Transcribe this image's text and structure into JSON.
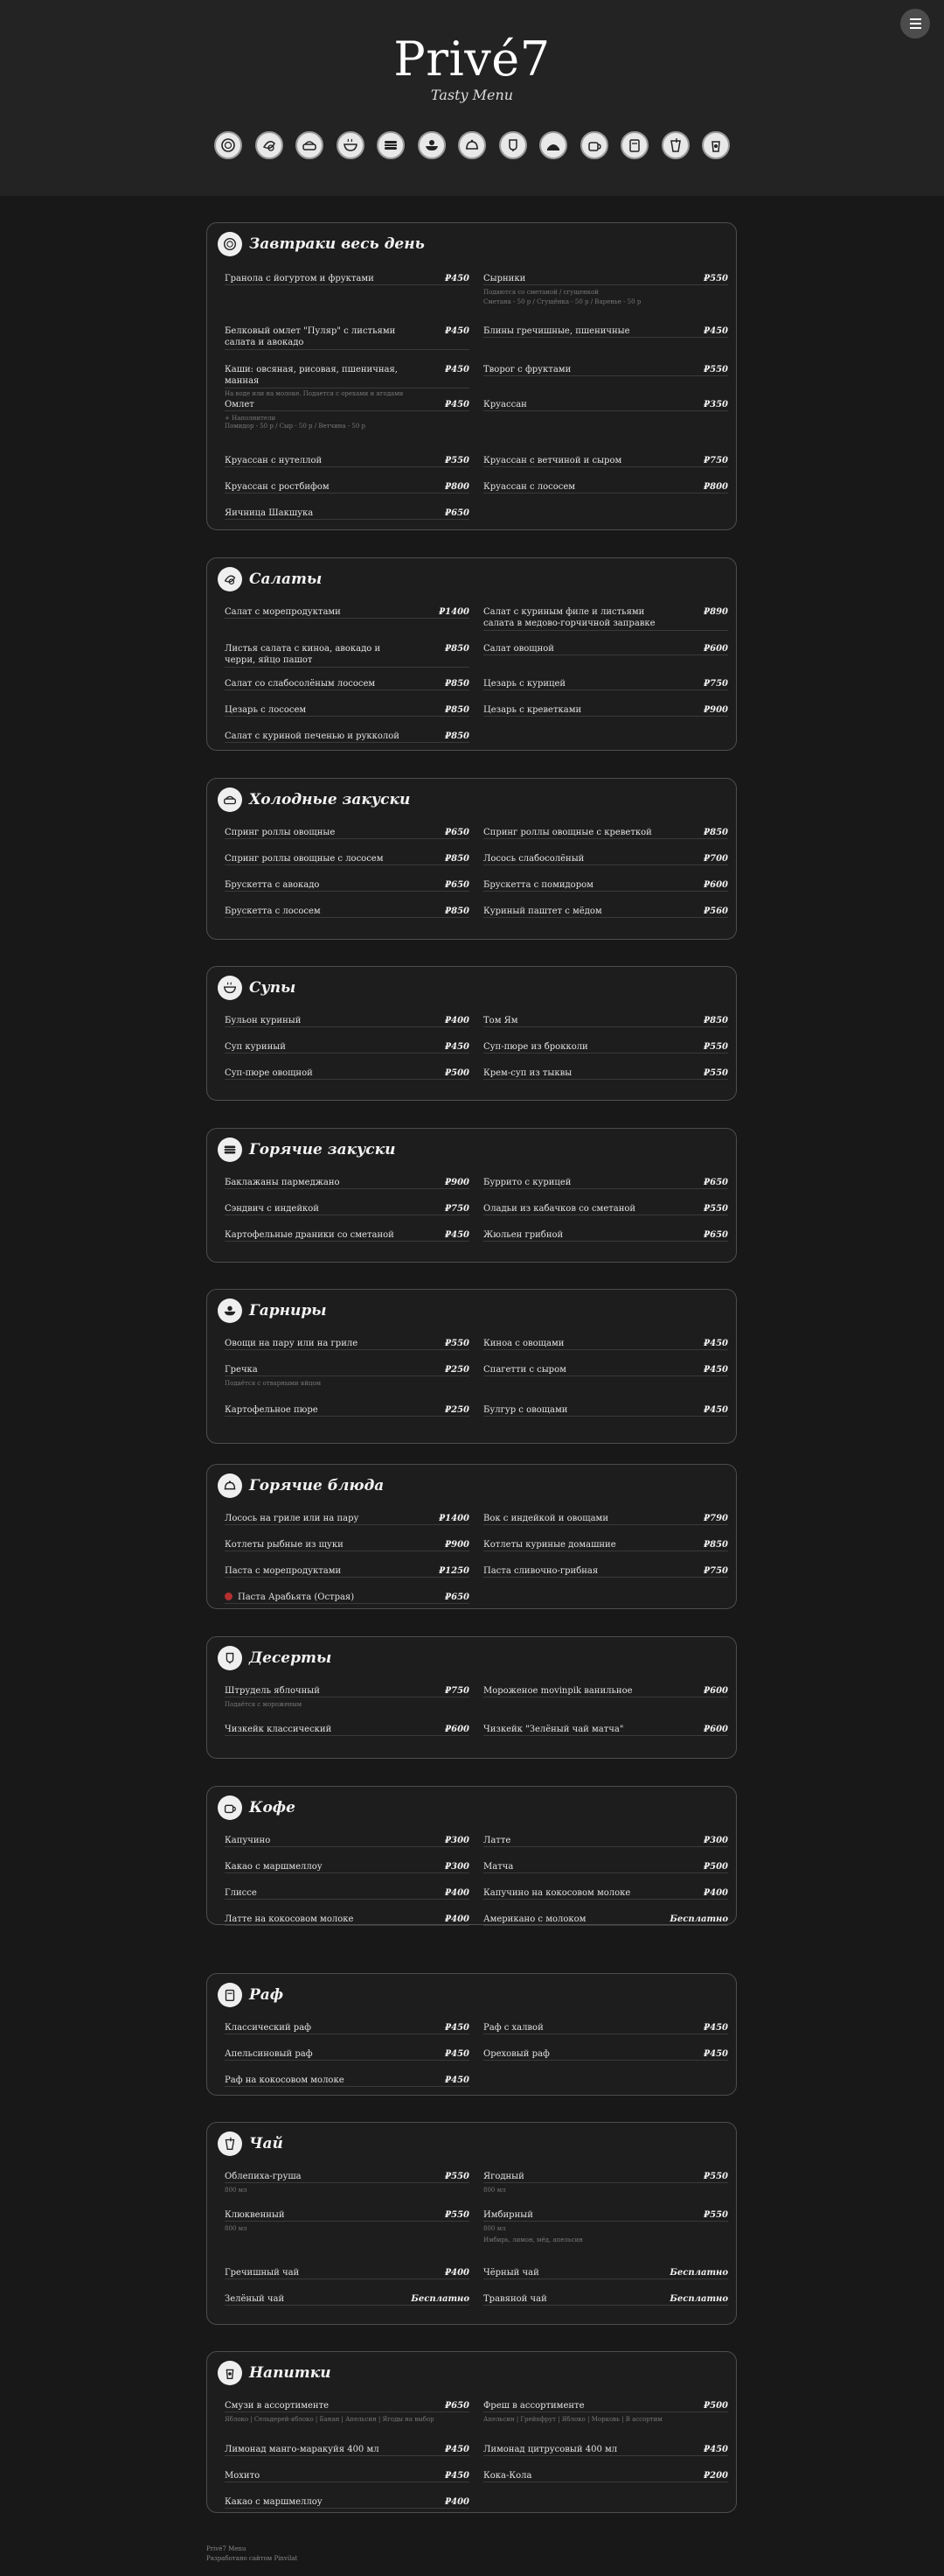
{
  "header": {
    "logo": "Privé7",
    "tagline": "Tasty Menu"
  },
  "categories": [
    "breakfast-icon",
    "salad-icon",
    "cold-appetizers-icon",
    "soup-icon",
    "hot-appetizers-icon",
    "side-dishes-icon",
    "main-courses-icon",
    "desserts-icon",
    "coffee-icon",
    "raf-icon",
    "tea-icon",
    "drinks-icon",
    "extra-icon"
  ],
  "sections": [
    {
      "title": "Завтраки весь день",
      "items": [
        {
          "name": "Гранола с йогуртом и фруктами",
          "price": "₽450"
        },
        {
          "name": "Сырники",
          "price": "₽550",
          "desc": "Подаются со сметаной / сгущенкой"
        },
        {
          "name": "",
          "price": "",
          "desc": "Сметана - 50 р / Сгущёнка - 50 р / Варенье - 50 р"
        },
        {
          "name": "Белковый омлет \"Пуляр\" с листьями салата и авокадо",
          "price": "₽450"
        },
        {
          "name": "Блины гречишные, пшеничные",
          "price": "₽450"
        },
        {
          "name": "Каши: овсяная, рисовая, пшеничная, манная",
          "price": "₽450",
          "desc": "На воде или на молоке. Подается с орехами и ягодами"
        },
        {
          "name": "Творог с фруктами",
          "price": "₽550"
        },
        {
          "name": "Омлет",
          "price": "₽450",
          "desc": "+ Наполнители"
        },
        {
          "name": "Круассан",
          "price": "₽350"
        },
        {
          "name": "",
          "price": "",
          "desc": "Помидор - 50 р / Сыр - 50 р / Ветчина - 50 р"
        },
        {
          "name": "Круассан с нутеллой",
          "price": "₽550"
        },
        {
          "name": "Круассан с ветчиной и сыром",
          "price": "₽750"
        },
        {
          "name": "Круассан с ростбифом",
          "price": "₽800"
        },
        {
          "name": "Круассан с лососем",
          "price": "₽800"
        },
        {
          "name": "Яичница Шакшука",
          "price": "₽650"
        }
      ]
    },
    {
      "title": "Салаты",
      "items": [
        {
          "name": "Салат с морепродуктами",
          "price": "₽1400"
        },
        {
          "name": "Салат с куриным филе и листьями салата в медово-горчичной заправке",
          "price": "₽890"
        },
        {
          "name": "Листья салата с киноа, авокадо и черри, яйцо пашот",
          "price": "₽850"
        },
        {
          "name": "Салат овощной",
          "price": "₽600"
        },
        {
          "name": "Салат со слабосолёным лососем",
          "price": "₽850"
        },
        {
          "name": "Цезарь с курицей",
          "price": "₽750"
        },
        {
          "name": "Цезарь с лососем",
          "price": "₽850"
        },
        {
          "name": "Цезарь с креветками",
          "price": "₽900"
        },
        {
          "name": "Салат с куриной печенью и рукколой",
          "price": "₽850"
        }
      ]
    },
    {
      "title": "Холодные закуски",
      "items": [
        {
          "name": "Спринг роллы овощные",
          "price": "₽650"
        },
        {
          "name": "Спринг роллы овощные с креветкой",
          "price": "₽850"
        },
        {
          "name": "Спринг роллы овощные с лососем",
          "price": "₽850"
        },
        {
          "name": "Лосось слабосолёный",
          "price": "₽700"
        },
        {
          "name": "Брускетта с авокадо",
          "price": "₽650"
        },
        {
          "name": "Брускетта с помидором",
          "price": "₽600"
        },
        {
          "name": "Брускетта с лососем",
          "price": "₽850"
        },
        {
          "name": "Куриный паштет с мёдом",
          "price": "₽560"
        }
      ]
    },
    {
      "title": "Супы",
      "items": [
        {
          "name": "Бульон куриный",
          "price": "₽400"
        },
        {
          "name": "Том Ям",
          "price": "₽850"
        },
        {
          "name": "Суп куриный",
          "price": "₽450"
        },
        {
          "name": "Суп-пюре из брокколи",
          "price": "₽550"
        },
        {
          "name": "Суп-пюре овощной",
          "price": "₽500"
        },
        {
          "name": "Крем-суп из тыквы",
          "price": "₽550"
        }
      ]
    },
    {
      "title": "Горячие закуски",
      "items": [
        {
          "name": "Баклажаны пармеджано",
          "price": "₽900"
        },
        {
          "name": "Буррито с курицей",
          "price": "₽650"
        },
        {
          "name": "Сэндвич с индейкой",
          "price": "₽750"
        },
        {
          "name": "Оладьи из кабачков со сметаной",
          "price": "₽550"
        },
        {
          "name": "Картофельные драники со сметаной",
          "price": "₽450"
        },
        {
          "name": "Жюльен грибной",
          "price": "₽650"
        }
      ]
    },
    {
      "title": "Гарниры",
      "items": [
        {
          "name": "Овощи на пару или на гриле",
          "price": "₽550"
        },
        {
          "name": "Киноа с овощами",
          "price": "₽450"
        },
        {
          "name": "Гречка",
          "price": "₽250",
          "desc": "Подаётся с отварными яйцом"
        },
        {
          "name": "Спагетти с сыром",
          "price": "₽450"
        },
        {
          "name": "Картофельное пюре",
          "price": "₽250"
        },
        {
          "name": "Булгур с овощами",
          "price": "₽450"
        }
      ]
    },
    {
      "title": "Горячие блюда",
      "items": [
        {
          "name": "Лосось на гриле или на пару",
          "price": "₽1400"
        },
        {
          "name": "Вок с индейкой и овощами",
          "price": "₽790"
        },
        {
          "name": "Котлеты рыбные из щуки",
          "price": "₽900"
        },
        {
          "name": "Котлеты куриные домашние",
          "price": "₽850"
        },
        {
          "name": "Паста с морепродуктами",
          "price": "₽1250"
        },
        {
          "name": "Паста сливочно-грибная",
          "price": "₽750"
        },
        {
          "name": "Паста Арабьята (Острая)",
          "price": "₽650",
          "hot": true
        }
      ]
    },
    {
      "title": "Десерты",
      "items": [
        {
          "name": "Штрудель яблочный",
          "price": "₽750",
          "desc": "Подаётся с мороженым"
        },
        {
          "name": "Мороженое movinpik ванильное",
          "price": "₽600"
        },
        {
          "name": "Чизкейк классический",
          "price": "₽600"
        },
        {
          "name": "Чизкейк \"Зелёный чай матча\"",
          "price": "₽600"
        }
      ]
    },
    {
      "title": "Кофе",
      "items": [
        {
          "name": "Капучино",
          "price": "₽300"
        },
        {
          "name": "Латте",
          "price": "₽300"
        },
        {
          "name": "Какао с маршмеллоу",
          "price": "₽300"
        },
        {
          "name": "Матча",
          "price": "₽500"
        },
        {
          "name": "Глиссе",
          "price": "₽400"
        },
        {
          "name": "Капучино на кокосовом молоке",
          "price": "₽400"
        },
        {
          "name": "Латте на кокосовом молоке",
          "price": "₽400"
        },
        {
          "name": "Американо с молоком",
          "price": "Бесплатно"
        }
      ]
    },
    {
      "title": "Раф",
      "items": [
        {
          "name": "Классический раф",
          "price": "₽450"
        },
        {
          "name": "Раф с халвой",
          "price": "₽450"
        },
        {
          "name": "Апельсиновый раф",
          "price": "₽450"
        },
        {
          "name": "Ореховый раф",
          "price": "₽450"
        },
        {
          "name": "Раф на кокосовом молоке",
          "price": "₽450"
        }
      ]
    },
    {
      "title": "Чай",
      "items": [
        {
          "name": "Облепиха-груша",
          "price": "₽550",
          "desc": "800 мл"
        },
        {
          "name": "Ягодный",
          "price": "₽550",
          "desc": "800 мл"
        },
        {
          "name": "Клюквенный",
          "price": "₽550",
          "desc": "800 мл"
        },
        {
          "name": "Имбирный",
          "price": "₽550",
          "desc": "800 мл"
        },
        {
          "name": "",
          "price": "",
          "desc": "Имбирь, лимон, мёд, апельсин"
        },
        {
          "name": "Гречишный чай",
          "price": "₽400"
        },
        {
          "name": "Чёрный чай",
          "price": "Бесплатно"
        },
        {
          "name": "Зелёный чай",
          "price": "Бесплатно"
        },
        {
          "name": "Травяной чай",
          "price": "Бесплатно"
        }
      ]
    },
    {
      "title": "Напитки",
      "items": [
        {
          "name": "Смузи в ассортименте",
          "price": "₽650",
          "desc": "Яблоко | Сельдерей-яблоко | Банан | Апельсин | Ягоды на выбор"
        },
        {
          "name": "Фреш в ассортименте",
          "price": "₽500",
          "desc": "Апельсин | Грейпфрут | Яблоко | Морковь | В ассортим"
        },
        {
          "name": "Лимонад манго-маракуйя 400 мл",
          "price": "₽450"
        },
        {
          "name": "Лимонад цитрусовый 400 мл",
          "price": "₽450"
        },
        {
          "name": "Мохито",
          "price": "₽450"
        },
        {
          "name": "Кока-Кола",
          "price": "₽200"
        },
        {
          "name": "Какао с маршмеллоу",
          "price": "₽400"
        }
      ]
    }
  ],
  "footer": {
    "line1": "Privé7 Menu",
    "line2": "Разработано сайтом Pinvilat"
  }
}
